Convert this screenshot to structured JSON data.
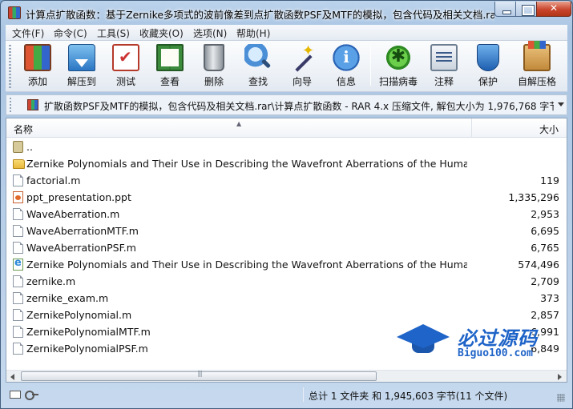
{
  "window": {
    "title": "计算点扩散函数：基于Zernike多项式的波前像差到点扩散函数PSF及MTF的模拟，包含代码及相关文档.rar"
  },
  "menu": [
    "文件(F)",
    "命令(C)",
    "工具(S)",
    "收藏夹(O)",
    "选项(N)",
    "帮助(H)"
  ],
  "toolbar": [
    {
      "label": "添加",
      "icon": "add-archive-icon"
    },
    {
      "label": "解压到",
      "icon": "extract-to-icon"
    },
    {
      "label": "测试",
      "icon": "test-icon"
    },
    {
      "label": "查看",
      "icon": "view-book-icon"
    },
    {
      "label": "删除",
      "icon": "trash-icon"
    },
    {
      "label": "查找",
      "icon": "magnifier-icon"
    },
    {
      "label": "向导",
      "icon": "wizard-wand-icon"
    },
    {
      "label": "信息",
      "icon": "info-icon"
    },
    {
      "label": "扫描病毒",
      "icon": "virus-scan-icon"
    },
    {
      "label": "注释",
      "icon": "comment-icon"
    },
    {
      "label": "保护",
      "icon": "shield-icon"
    },
    {
      "label": "自解压格",
      "icon": "sfx-icon"
    }
  ],
  "address": {
    "path": "扩散函数PSF及MTF的模拟，包含代码及相关文档.rar\\计算点扩散函数 - RAR 4.x 压缩文件, 解包大小为 1,976,768 字节"
  },
  "list": {
    "columns": {
      "name": "名称",
      "size": "大小"
    },
    "rows": [
      {
        "name": "..",
        "size": "",
        "type": "up"
      },
      {
        "name": "Zernike Polynomials and Their Use in Describing the Wavefront Aberrations of the Human Ey...",
        "size": "",
        "type": "folder"
      },
      {
        "name": "factorial.m",
        "size": "119",
        "type": "file"
      },
      {
        "name": "ppt_presentation.ppt",
        "size": "1,335,296",
        "type": "ppt"
      },
      {
        "name": "WaveAberration.m",
        "size": "2,953",
        "type": "file"
      },
      {
        "name": "WaveAberrationMTF.m",
        "size": "6,695",
        "type": "file"
      },
      {
        "name": "WaveAberrationPSF.m",
        "size": "6,765",
        "type": "file"
      },
      {
        "name": "Zernike Polynomials and Their Use in Describing the Wavefront Aberrations of the Human Ey...",
        "size": "574,496",
        "type": "html"
      },
      {
        "name": "zernike.m",
        "size": "2,709",
        "type": "file"
      },
      {
        "name": "zernike_exam.m",
        "size": "373",
        "type": "file"
      },
      {
        "name": "ZernikePolynomial.m",
        "size": "2,857",
        "type": "file"
      },
      {
        "name": "ZernikePolynomialMTF.m",
        "size": "6,991",
        "type": "file"
      },
      {
        "name": "ZernikePolynomialPSF.m",
        "size": "6,849",
        "type": "file"
      }
    ]
  },
  "watermark": {
    "title": "必过源码",
    "subtitle": "Biguo100.com"
  },
  "status": {
    "summary": "总计 1 文件夹 和 1,945,603 字节(11 个文件)"
  }
}
